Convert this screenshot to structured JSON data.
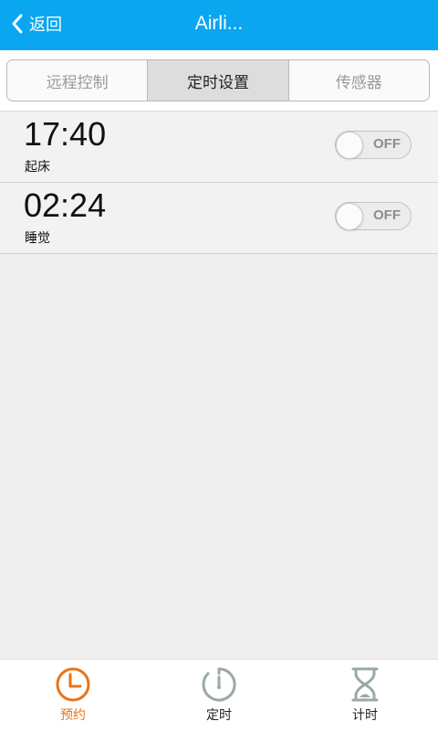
{
  "header": {
    "back_label": "返回",
    "title": "Airli..."
  },
  "tabs": [
    {
      "label": "远程控制",
      "active": false
    },
    {
      "label": "定时设置",
      "active": true
    },
    {
      "label": "传感器",
      "active": false
    }
  ],
  "timers": [
    {
      "time": "17:40",
      "label": "起床",
      "switch": "OFF"
    },
    {
      "time": "02:24",
      "label": "睡觉",
      "switch": "OFF"
    }
  ],
  "bottom_nav": [
    {
      "label": "预约",
      "icon": "clock-icon",
      "active": true
    },
    {
      "label": "定时",
      "icon": "timer-icon",
      "active": false
    },
    {
      "label": "计时",
      "icon": "hourglass-icon",
      "active": false
    }
  ],
  "colors": {
    "header_bg": "#0aa6ef",
    "accent": "#e8731a",
    "inactive_icon": "#9aa8a8"
  }
}
